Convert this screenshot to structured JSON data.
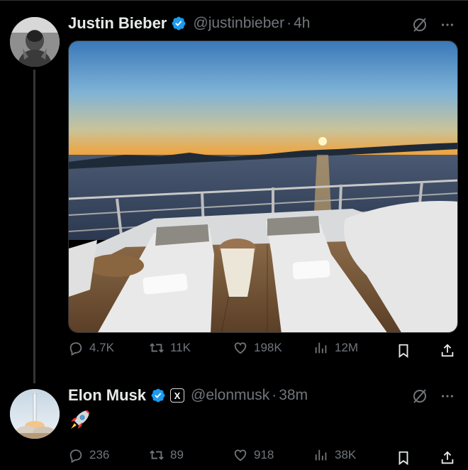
{
  "tweets": [
    {
      "name": "Justin Bieber",
      "handle": "@justinbieber",
      "sep": "·",
      "time": "4h",
      "verified": true,
      "affiliate_badge": null,
      "media": "yacht-deck-sunset-photo",
      "stats": {
        "replies": "4.7K",
        "reposts": "11K",
        "likes": "198K",
        "views": "12M"
      }
    },
    {
      "name": "Elon Musk",
      "handle": "@elonmusk",
      "sep": "·",
      "time": "38m",
      "verified": true,
      "affiliate_badge": "X",
      "body": "🚀",
      "stats": {
        "replies": "236",
        "reposts": "89",
        "likes": "918",
        "views": "38K"
      }
    }
  ],
  "icons": [
    "verified-badge-icon",
    "grok-icon",
    "more-icon",
    "reply-icon",
    "repost-icon",
    "like-icon",
    "views-icon",
    "bookmark-icon",
    "share-icon",
    "rocket-emoji-icon"
  ],
  "colors": {
    "background": "#000000",
    "text": "#e7e9ea",
    "muted": "#71767b",
    "verified": "#1d9bf0",
    "divider": "#2f3336"
  }
}
